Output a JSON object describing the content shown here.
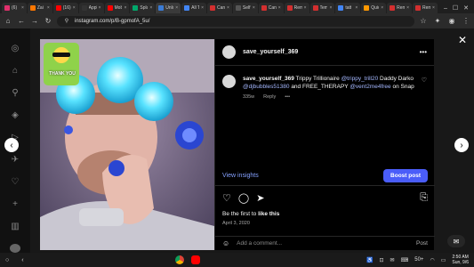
{
  "browser": {
    "tabs": [
      {
        "label": "(6)",
        "color": "#e1306c",
        "active": false
      },
      {
        "label": "Zai",
        "color": "#ff7700",
        "active": false
      },
      {
        "label": "(16)",
        "color": "#ff0000",
        "active": false
      },
      {
        "label": "Appl",
        "color": "#333333",
        "active": false
      },
      {
        "label": "Mobi",
        "color": "#ff0000",
        "active": false
      },
      {
        "label": "Spla",
        "color": "#00a86b",
        "active": false
      },
      {
        "label": "Unlo",
        "color": "#3a7bd5",
        "active": true
      },
      {
        "label": "All T",
        "color": "#4285f4",
        "active": false
      },
      {
        "label": "Cana",
        "color": "#d32f2f",
        "active": false
      },
      {
        "label": "Self",
        "color": "#555555",
        "active": false
      },
      {
        "label": "Cana",
        "color": "#d32f2f",
        "active": false
      },
      {
        "label": "Rem",
        "color": "#d32f2f",
        "active": false
      },
      {
        "label": "Tem",
        "color": "#d32f2f",
        "active": false
      },
      {
        "label": "tatt",
        "color": "#4285f4",
        "active": false
      },
      {
        "label": "Quic",
        "color": "#ff9800",
        "active": false
      },
      {
        "label": "Rem",
        "color": "#d32f2f",
        "active": false
      },
      {
        "label": "Rem",
        "color": "#d32f2f",
        "active": false
      }
    ],
    "url": "instagram.com/p/B-gpmofA_5u/"
  },
  "post": {
    "username": "save_yourself_369",
    "caption_user": "save_yourself_369",
    "caption_part1": " Trippy Trillionaire ",
    "mention1": "@trippy_trill20",
    "caption_part2": " Daddy Darko ",
    "mention2": "@djbubbles51380",
    "caption_part3": " and FREE_THERAPY ",
    "mention3": "@vent2me4free",
    "caption_part4": " on Snap",
    "age": "335w",
    "reply": "Reply",
    "more": "•••",
    "view_insights": "View insights",
    "boost": "Boost post",
    "like_prefix": "Be the first to ",
    "like_action": "like this",
    "date": "April 3, 2020",
    "comment_placeholder": "Add a comment...",
    "post_label": "Post"
  },
  "photo_sticker_text": "THANK YOU",
  "shelf": {
    "battery": "50+",
    "time": "2:50 AM",
    "date": "Sun, 9/6"
  }
}
